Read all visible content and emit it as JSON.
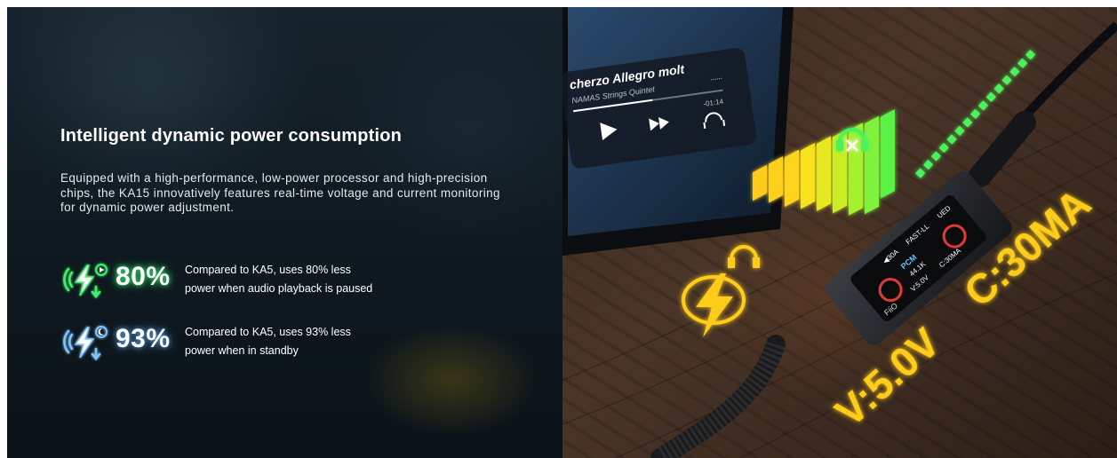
{
  "headline": "Intelligent dynamic power consumption",
  "description": "Equipped with a high-performance, low-power processor and high-precision chips, the KA15 innovatively features real-time voltage and current monitoring for dynamic power adjustment.",
  "stats": [
    {
      "percent": "80%",
      "text_line1": "Compared to KA5, uses 80% less",
      "text_line2": "power when audio playback is paused",
      "icon": "bolt-play-icon",
      "color": "#3cf36a"
    },
    {
      "percent": "93%",
      "text_line1": "Compared to KA5, uses 93% less",
      "text_line2": "power when in standby",
      "icon": "bolt-moon-icon",
      "color": "#7ec4ff"
    }
  ],
  "phone": {
    "track_title": "cherzo Allegro molt",
    "track_artist": "NAMAS Strings Quintet",
    "time_remaining": "-01:14",
    "more_dots": "......"
  },
  "device_screen": {
    "brand": "FiiO",
    "sample_rate_label": "FAST-LL",
    "output_label": "UED",
    "volume": "◀30A",
    "format": "PCM",
    "frequency": "44.1K",
    "voltage": "V:5.0V",
    "current": "C:30MA"
  },
  "overlay_labels": {
    "current": "C:30MA",
    "voltage": "V:5.0V"
  },
  "colors": {
    "accent_green": "#3cf36a",
    "accent_yellow": "#ffcc1a",
    "accent_blue": "#7ec4ff",
    "background": "#0d1318"
  }
}
